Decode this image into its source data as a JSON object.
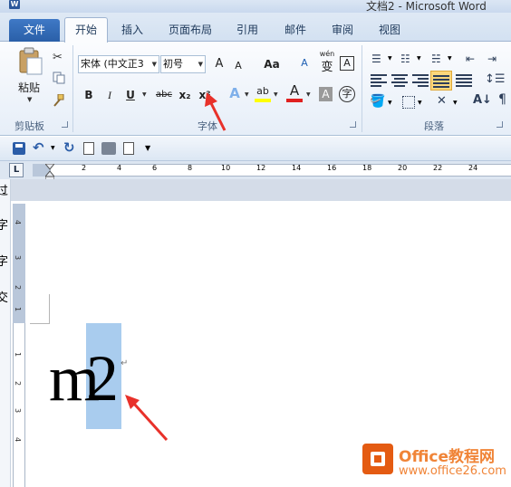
{
  "window": {
    "title": "文档2 - Microsoft Word",
    "app_icon_letter": "W"
  },
  "tabs": [
    {
      "label": "文件"
    },
    {
      "label": "开始"
    },
    {
      "label": "插入"
    },
    {
      "label": "页面布局"
    },
    {
      "label": "引用"
    },
    {
      "label": "邮件"
    },
    {
      "label": "审阅"
    },
    {
      "label": "视图"
    }
  ],
  "ribbon": {
    "clipboard": {
      "label": "剪贴板",
      "paste_label": "粘贴"
    },
    "font": {
      "label": "字体",
      "font_name": "宋体 (中文正3",
      "font_size": "初号",
      "grow_label": "A",
      "shrink_label": "A",
      "change_case_label": "Aa",
      "clear_format_label": "A",
      "phonetic_label": "wén",
      "phonetic_char": "变",
      "char_border_label": "A",
      "bold_label": "B",
      "italic_label": "I",
      "underline_label": "U",
      "strike_label": "abc",
      "subscript_label": "x₂",
      "superscript_label": "x²",
      "effects_label": "A",
      "highlight_label": "ab",
      "font_color_label": "A",
      "shading_label": "A",
      "enclose_char": "字",
      "highlight_color": "#ffff00",
      "font_color": "#e02020"
    },
    "paragraph": {
      "label": "段落"
    }
  },
  "ruler": {
    "ticks": [
      "2",
      "4",
      "6",
      "8",
      "10",
      "12",
      "14",
      "16",
      "18",
      "20",
      "22",
      "24"
    ]
  },
  "vruler": {
    "ticks": [
      "4",
      "3",
      "2",
      "1",
      "1",
      "2",
      "3",
      "4"
    ]
  },
  "document": {
    "text_base": "m",
    "text_superscript_selected": "2",
    "paragraph_mark": "↵"
  },
  "left_panel_chars": [
    "过",
    "字",
    "字",
    "交"
  ],
  "watermark": {
    "title": "Office教程网",
    "url": "www.office26.com"
  },
  "colors": {
    "accent_blue": "#2b579a",
    "selection": "#a9ccee",
    "arrow": "#e8312a"
  }
}
